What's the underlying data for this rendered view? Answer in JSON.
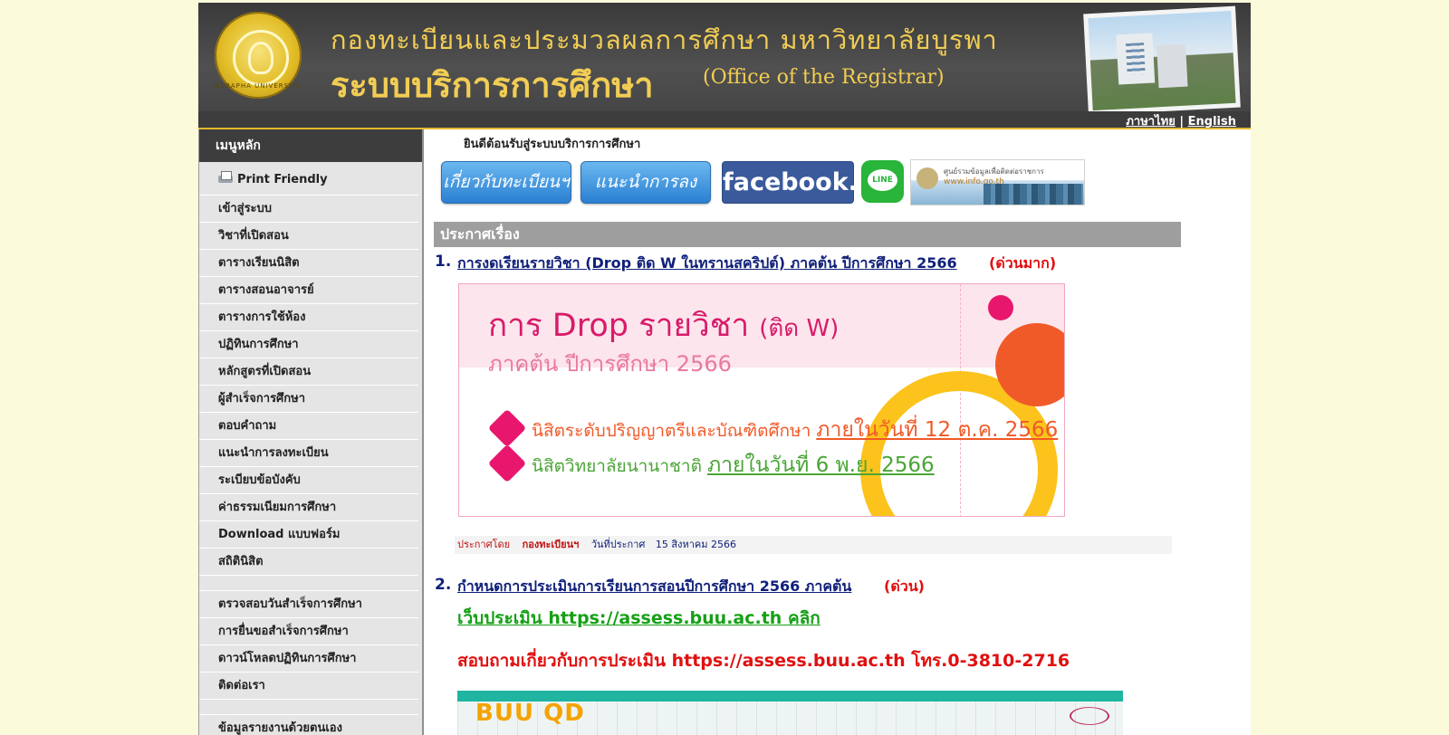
{
  "header": {
    "title_line1": "กองทะเบียนและประมวลผลการศึกษา มหาวิทยาลัยบูรพา",
    "title_line2": "ระบบบริการการศึกษา",
    "title_line2_en": "(Office of the Registrar)",
    "seal_text": "BURAPHA UNIVERSITY",
    "lang_thai": "ภาษาไทย",
    "lang_sep": "|",
    "lang_en": "English"
  },
  "sidebar": {
    "heading": "เมนูหลัก",
    "print_label": "Print Friendly",
    "items": [
      "เข้าสู่ระบบ",
      "วิชาที่เปิดสอน",
      "ตารางเรียนนิสิต",
      "ตารางสอนอาจารย์",
      "ตารางการใช้ห้อง",
      "ปฏิทินการศึกษา",
      "หลักสูตรที่เปิดสอน",
      "ผู้สำเร็จการศึกษา",
      "ตอบคำถาม",
      "แนะนำการลงทะเบียน",
      "ระเบียบข้อบังคับ",
      "ค่าธรรมเนียมการศึกษา",
      "Download แบบฟอร์ม",
      "สถิตินิสิต"
    ],
    "items2": [
      "ตรวจสอบวันสำเร็จการศึกษา",
      "การยื่นขอสำเร็จการศึกษา",
      "ดาวน์โหลดปฏิทินการศึกษา",
      "ติดต่อเรา",
      "ข้อมูลรายงานด้วยตนเอง"
    ]
  },
  "main": {
    "welcome": "ยินดีต้อนรับสู่ระบบบริการการศึกษา",
    "buttons": {
      "about": "เกี่ยวกับทะเบียนฯ",
      "guide": "แนะนำการลงทะเบียน",
      "facebook": "facebook.",
      "line": "LINE",
      "info_text": "ศูนย์รวมข้อมูลเพื่อติดต่อราชการ",
      "info_url": "www.info.go.th"
    },
    "news_heading": "ประกาศเรื่อง",
    "news": [
      {
        "num": "1.",
        "title": "การงดเรียนรายวิชา (Drop ติด W ในทรานสคริปต์) ภาคต้น ปีการศึกษา 2566",
        "urgency": "(ด่วนมาก)",
        "banner": {
          "title": "การ Drop รายวิชา",
          "title_small": "(ติด W)",
          "subtitle": "ภาคต้น ปีการศึกษา 2566",
          "line1_text": "นิสิตระดับปริญญาตรีและบัณฑิตศึกษา ",
          "line1_date": "ภายในวันที่ 12 ต.ค. 2566",
          "line2_text": "นิสิตวิทยาลัยนานาชาติ ",
          "line2_date": "ภายในวันที่ 6 พ.ย. 2566"
        },
        "posted_label": "ประกาศโดย",
        "posted_by": "กองทะเบียนฯ",
        "date_label": "วันที่ประกาศ",
        "date": "15 สิงหาคม 2566"
      },
      {
        "num": "2.",
        "title": "กำหนดการประเมินการเรียนการสอนปีการศึกษา 2566 ภาคต้น",
        "urgency": "(ด่วน)",
        "link_line": "เว็บประเมิน https://assess.buu.ac.th คลิก",
        "contact_line": "สอบถามเกี่ยวกับการประเมิน https://assess.buu.ac.th โทร.0-3810-2716",
        "banner_logo": "BUU QD"
      }
    ]
  },
  "colors": {
    "page_bg": "#fbfbdc",
    "header_bg": "#454545",
    "header_gold": "#f2cd54",
    "link_navy": "#10207a",
    "urgent_red": "#e01010",
    "green": "#16a016"
  }
}
